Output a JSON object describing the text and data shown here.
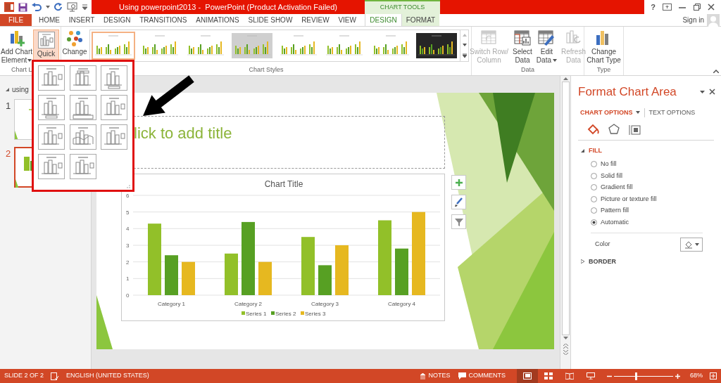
{
  "window": {
    "title": "Using powerpoint2013 -  PowerPoint (Product Activation Failed)",
    "context_tab_group": "CHART TOOLS",
    "help": "?"
  },
  "tabs": [
    {
      "label": "FILE",
      "kind": "file",
      "selected": false
    },
    {
      "label": "HOME",
      "kind": "main",
      "selected": false
    },
    {
      "label": "INSERT",
      "kind": "main",
      "selected": false
    },
    {
      "label": "DESIGN",
      "kind": "main",
      "selected": false
    },
    {
      "label": "TRANSITIONS",
      "kind": "main",
      "selected": false
    },
    {
      "label": "ANIMATIONS",
      "kind": "main",
      "selected": false
    },
    {
      "label": "SLIDE SHOW",
      "kind": "main",
      "selected": false
    },
    {
      "label": "REVIEW",
      "kind": "main",
      "selected": false
    },
    {
      "label": "VIEW",
      "kind": "main",
      "selected": false
    },
    {
      "label": "DESIGN",
      "kind": "context",
      "selected": true
    },
    {
      "label": "FORMAT",
      "kind": "context",
      "selected": false
    }
  ],
  "account": {
    "sign_in": "Sign in"
  },
  "ribbon": {
    "chart_layouts": {
      "label": "Chart L",
      "add_chart_element": [
        "Add Chart",
        "Element"
      ],
      "quick_layout": {
        "label": "Quick",
        "selected": true
      }
    },
    "chart_styles": {
      "label": "Chart Styles",
      "change_colors": "Change",
      "styles": [
        {
          "kind": "white",
          "selected": true
        },
        {
          "kind": "white",
          "selected": false
        },
        {
          "kind": "white",
          "selected": false
        },
        {
          "kind": "gray",
          "selected": false
        },
        {
          "kind": "white",
          "selected": false
        },
        {
          "kind": "white",
          "selected": false
        },
        {
          "kind": "white",
          "selected": false
        },
        {
          "kind": "dark",
          "selected": false
        }
      ]
    },
    "data": {
      "label": "Data",
      "commands": [
        {
          "kind": "switch",
          "lines": [
            "Switch Row/",
            "Column"
          ],
          "disabled": true,
          "dropdown": false
        },
        {
          "kind": "select",
          "lines": [
            "Select",
            "Data"
          ],
          "disabled": false,
          "dropdown": false
        },
        {
          "kind": "edit",
          "lines": [
            "Edit",
            "Data"
          ],
          "disabled": false,
          "dropdown": true
        },
        {
          "kind": "refresh",
          "lines": [
            "Refresh",
            "Data"
          ],
          "disabled": true,
          "dropdown": false
        }
      ]
    },
    "type": {
      "label": "Type",
      "commands": [
        {
          "kind": "type",
          "lines": [
            "Change",
            "Chart Type"
          ],
          "disabled": false,
          "dropdown": false
        }
      ]
    }
  },
  "slides_pane": {
    "section": "using",
    "slides": [
      {
        "number": "1",
        "kind": "title",
        "selected": false
      },
      {
        "number": "2",
        "kind": "chart",
        "selected": true
      }
    ]
  },
  "slide": {
    "title_placeholder": "lick to add title",
    "chart_data": {
      "type": "bar",
      "title": "Chart Title",
      "categories": [
        "Category 1",
        "Category 2",
        "Category 3",
        "Category 4"
      ],
      "series": [
        {
          "name": "Series 1",
          "color": "#92c029",
          "values": [
            4.3,
            2.5,
            3.5,
            4.5
          ]
        },
        {
          "name": "Series 2",
          "color": "#57a023",
          "values": [
            2.4,
            4.4,
            1.8,
            2.8
          ]
        },
        {
          "name": "Series 3",
          "color": "#e6b820",
          "values": [
            2,
            2,
            3,
            5
          ]
        }
      ],
      "ylim": [
        0,
        6
      ],
      "yticks": [
        0,
        1,
        2,
        3,
        4,
        5,
        6
      ],
      "grid": true,
      "legend": "bottom"
    }
  },
  "format_pane": {
    "title": "Format Chart Area",
    "tabs": [
      {
        "label": "CHART OPTIONS",
        "selected": true
      },
      {
        "label": "TEXT OPTIONS",
        "selected": false
      }
    ],
    "icon_tabs": [
      {
        "kind": "fill",
        "selected": true
      },
      {
        "kind": "effects",
        "selected": false
      },
      {
        "kind": "size",
        "selected": false
      }
    ],
    "sections": [
      {
        "label": "FILL",
        "expanded": true,
        "options": [
          {
            "label": "No fill",
            "selected": false
          },
          {
            "label": "Solid fill",
            "selected": false
          },
          {
            "label": "Gradient fill",
            "selected": false
          },
          {
            "label": "Picture or texture fill",
            "selected": false
          },
          {
            "label": "Pattern fill",
            "selected": false
          },
          {
            "label": "Automatic",
            "selected": true
          }
        ],
        "color_label": "Color"
      },
      {
        "label": "BORDER",
        "expanded": false
      }
    ]
  },
  "status_bar": {
    "slide": "SLIDE 2 OF 2",
    "language": "ENGLISH (UNITED STATES)",
    "notes": "NOTES",
    "comments": "COMMENTS",
    "views": [
      {
        "kind": "normal",
        "selected": true
      },
      {
        "kind": "sorter",
        "selected": false
      },
      {
        "kind": "reading",
        "selected": false
      },
      {
        "kind": "show",
        "selected": false
      }
    ],
    "zoom": {
      "level": 0.36,
      "reading": "68%"
    }
  }
}
